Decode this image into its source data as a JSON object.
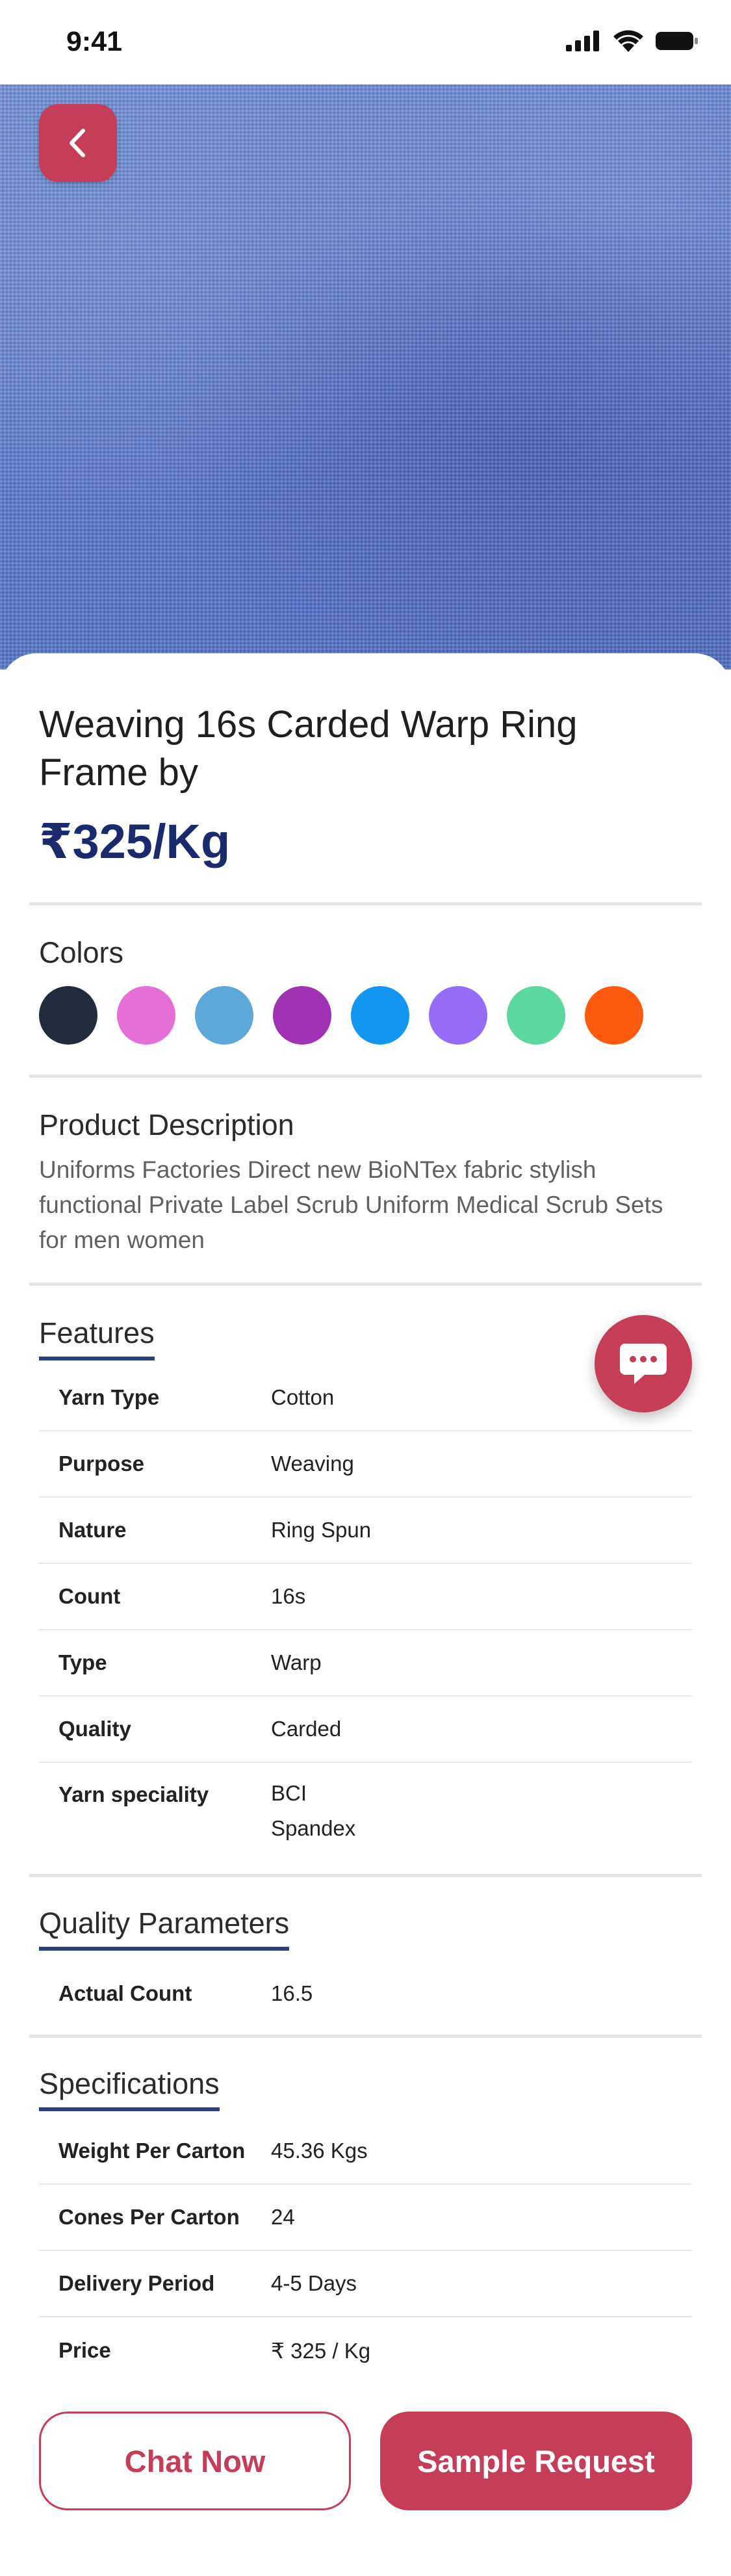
{
  "status_bar": {
    "time": "9:41"
  },
  "product": {
    "title": "Weaving 16s Carded Warp Ring Frame by",
    "price": "₹325/Kg"
  },
  "colors": {
    "label": "Colors",
    "swatches": [
      "#222b3c",
      "#e56fd6",
      "#5ca8d8",
      "#a032b4",
      "#1296f1",
      "#946cf6",
      "#5ad89e",
      "#fd5a0f"
    ]
  },
  "description": {
    "heading": "Product Description",
    "text": "Uniforms Factories Direct new BioNTex fabric stylish functional Private Label Scrub Uniform Medical Scrub Sets for men women"
  },
  "features": {
    "heading": "Features",
    "rows": [
      {
        "key": "Yarn Type",
        "value": "Cotton"
      },
      {
        "key": "Purpose",
        "value": "Weaving"
      },
      {
        "key": "Nature",
        "value": "Ring Spun"
      },
      {
        "key": "Count",
        "value": "16s"
      },
      {
        "key": "Type",
        "value": "Warp"
      },
      {
        "key": "Quality",
        "value": "Carded"
      },
      {
        "key": "Yarn speciality",
        "value": "BCI",
        "value2": "Spandex"
      }
    ]
  },
  "quality": {
    "heading": "Quality Parameters",
    "rows": [
      {
        "key": "Actual Count",
        "value": "16.5"
      }
    ]
  },
  "specifications": {
    "heading": "Specifications",
    "rows": [
      {
        "key": "Weight Per Carton",
        "value": "45.36 Kgs"
      },
      {
        "key": "Cones Per Carton",
        "value": "24"
      },
      {
        "key": "Delivery Period",
        "value": "4-5 Days"
      },
      {
        "key": "Price",
        "value": "₹ 325 / Kg"
      }
    ]
  },
  "actions": {
    "chat_now": "Chat Now",
    "sample_request": "Sample Request"
  },
  "theme": {
    "accent": "#c63d57",
    "price": "#1a2a6c",
    "underline": "#2c3f82"
  }
}
